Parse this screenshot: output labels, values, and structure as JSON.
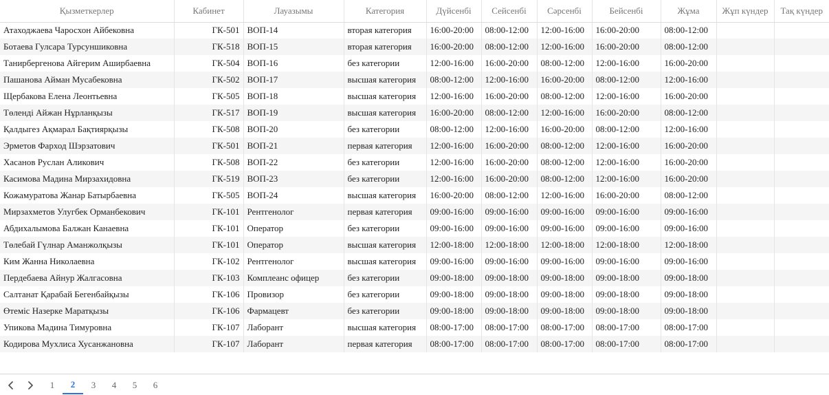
{
  "table": {
    "columns": [
      "Қызметкерлер",
      "Кабинет",
      "Лауазымы",
      "Категория",
      "Дүйсенбі",
      "Сейсенбі",
      "Сәрсенбі",
      "Бейсенбі",
      "Жұма",
      "Жұп күндер",
      "Тақ күндер"
    ],
    "rows": [
      [
        "Атаходжаева Чаросхон Айбековна",
        "ГК-501",
        "ВОП-14",
        "вторая категория",
        "16:00-20:00",
        "08:00-12:00",
        "12:00-16:00",
        "16:00-20:00",
        "08:00-12:00",
        "",
        ""
      ],
      [
        "Ботаева Гулсара Турсуншиковна",
        "ГК-518",
        "ВОП-15",
        "вторая категория",
        "16:00-20:00",
        "08:00-12:00",
        "12:00-16:00",
        "16:00-20:00",
        "08:00-12:00",
        "",
        ""
      ],
      [
        "Танирбергенова Айгерим Аширбаевна",
        "ГК-504",
        "ВОП-16",
        "без категории",
        "12:00-16:00",
        "16:00-20:00",
        "08:00-12:00",
        "12:00-16:00",
        "16:00-20:00",
        "",
        ""
      ],
      [
        "Пашанова Айман Мусабековна",
        "ГК-502",
        "ВОП-17",
        "высшая категория",
        "08:00-12:00",
        "12:00-16:00",
        "16:00-20:00",
        "08:00-12:00",
        "12:00-16:00",
        "",
        ""
      ],
      [
        "Щербакова Елена Леонтьевна",
        "ГК-505",
        "ВОП-18",
        "высшая категория",
        "12:00-16:00",
        "16:00-20:00",
        "08:00-12:00",
        "12:00-16:00",
        "16:00-20:00",
        "",
        ""
      ],
      [
        "Төленді Айжан Нұрланқызы",
        "ГК-517",
        "ВОП-19",
        "высшая категория",
        "16:00-20:00",
        "08:00-12:00",
        "12:00-16:00",
        "16:00-20:00",
        "08:00-12:00",
        "",
        ""
      ],
      [
        "Қалдыгез Ақмарал Бақтиярқызы",
        "ГК-508",
        "ВОП-20",
        "без категории",
        "08:00-12:00",
        "12:00-16:00",
        "16:00-20:00",
        "08:00-12:00",
        "12:00-16:00",
        "",
        ""
      ],
      [
        "Эрметов Фарход Шэрзатович",
        "ГК-501",
        "ВОП-21",
        "первая категория",
        "12:00-16:00",
        "16:00-20:00",
        "08:00-12:00",
        "12:00-16:00",
        "16:00-20:00",
        "",
        ""
      ],
      [
        "Хасанов Руслан Аликович",
        "ГК-508",
        "ВОП-22",
        "без категории",
        "12:00-16:00",
        "16:00-20:00",
        "08:00-12:00",
        "12:00-16:00",
        "16:00-20:00",
        "",
        ""
      ],
      [
        "Касимова Мадина Мирзахидовна",
        "ГК-519",
        "ВОП-23",
        "без категории",
        "12:00-16:00",
        "16:00-20:00",
        "08:00-12:00",
        "12:00-16:00",
        "16:00-20:00",
        "",
        ""
      ],
      [
        "Кожамуратова Жанар Батырбаевна",
        "ГК-505",
        "ВОП-24",
        "высшая категория",
        "16:00-20:00",
        "08:00-12:00",
        "12:00-16:00",
        "16:00-20:00",
        "08:00-12:00",
        "",
        ""
      ],
      [
        "Мирзахметов Улугбек Орманбекович",
        "ГК-101",
        "Рентгенолог",
        "первая категория",
        "09:00-16:00",
        "09:00-16:00",
        "09:00-16:00",
        "09:00-16:00",
        "09:00-16:00",
        "",
        ""
      ],
      [
        "Абдихалымова Балжан Канаевна",
        "ГК-101",
        "Оператор",
        "без категории",
        "09:00-16:00",
        "09:00-16:00",
        "09:00-16:00",
        "09:00-16:00",
        "09:00-16:00",
        "",
        ""
      ],
      [
        "Төлебай Гүлнар Аманжолқызы",
        "ГК-101",
        "Оператор",
        "высшая категория",
        "12:00-18:00",
        "12:00-18:00",
        "12:00-18:00",
        "12:00-18:00",
        "12:00-18:00",
        "",
        ""
      ],
      [
        "Ким Жанна Николаевна",
        "ГК-102",
        "Рентгенолог",
        "высшая категория",
        "09:00-16:00",
        "09:00-16:00",
        "09:00-16:00",
        "09:00-16:00",
        "09:00-16:00",
        "",
        ""
      ],
      [
        "Пердебаева Айнур Жалгасовна",
        "ГК-103",
        "Комплеанс офицер",
        "без категории",
        "09:00-18:00",
        "09:00-18:00",
        "09:00-18:00",
        "09:00-18:00",
        "09:00-18:00",
        "",
        ""
      ],
      [
        "Салтанат Қарабай Бегенбайқызы",
        "ГК-106",
        "Провизор",
        "без категории",
        "09:00-18:00",
        "09:00-18:00",
        "09:00-18:00",
        "09:00-18:00",
        "09:00-18:00",
        "",
        ""
      ],
      [
        "Өтеміс Назерке Маратқызы",
        "ГК-106",
        "Фармацевт",
        "без категории",
        "09:00-18:00",
        "09:00-18:00",
        "09:00-18:00",
        "09:00-18:00",
        "09:00-18:00",
        "",
        ""
      ],
      [
        "Упикова Мадина Тимуровна",
        "ГК-107",
        "Лаборант",
        "высшая категория",
        "08:00-17:00",
        "08:00-17:00",
        "08:00-17:00",
        "08:00-17:00",
        "08:00-17:00",
        "",
        ""
      ],
      [
        "Кодирова Мухлиса Хусанжановна",
        "ГК-107",
        "Лаборант",
        "первая категория",
        "08:00-17:00",
        "08:00-17:00",
        "08:00-17:00",
        "08:00-17:00",
        "08:00-17:00",
        "",
        ""
      ]
    ]
  },
  "pagination": {
    "prev_icon": "chevron-left-icon",
    "next_icon": "chevron-right-icon",
    "pages": [
      "1",
      "2",
      "3",
      "4",
      "5",
      "6"
    ],
    "current_page": "2",
    "accent_color": "#2f6fe0"
  }
}
